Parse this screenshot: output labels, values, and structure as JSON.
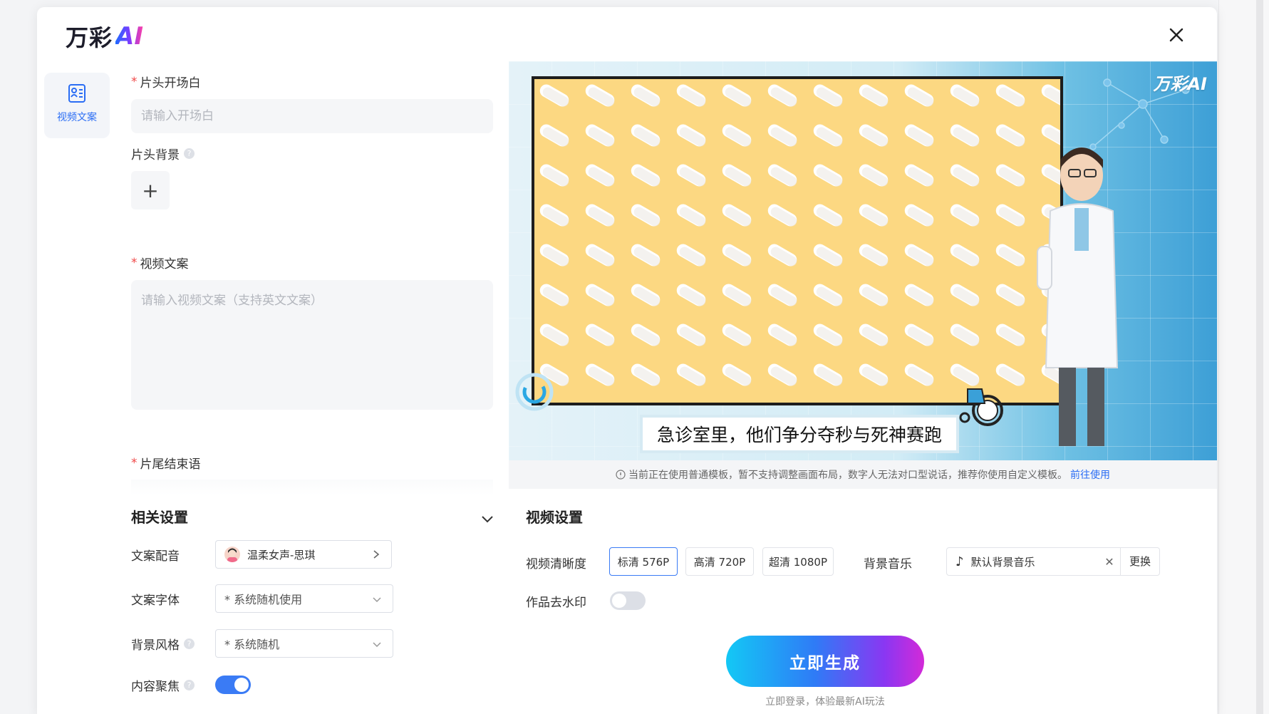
{
  "logo": {
    "text": "万彩",
    "ai": "AI"
  },
  "sidenav": {
    "label": "视频文案"
  },
  "form": {
    "opening": {
      "label": "片头开场白",
      "placeholder": "请输入开场白"
    },
    "opening_bg": {
      "label": "片头背景",
      "add": "+"
    },
    "script": {
      "label": "视频文案",
      "placeholder": "请输入视频文案（支持英文文案）"
    },
    "ending": {
      "label": "片尾结束语"
    }
  },
  "related": {
    "title": "相关设置",
    "voice": {
      "label": "文案配音",
      "value": "温柔女声-思琪"
    },
    "font": {
      "label": "文案字体",
      "value": "* 系统随机使用"
    },
    "bg_style": {
      "label": "背景风格",
      "value": "* 系统随机"
    },
    "focus": {
      "label": "内容聚焦",
      "on": true
    }
  },
  "preview": {
    "caption": "急诊室里，他们争分夺秒与死神赛跑",
    "watermark": "万彩AI"
  },
  "notice": {
    "text": "当前正在使用普通模板，暂不支持调整画面布局，数字人无法对口型说话，推荐你使用自定义模板。",
    "link": "前往使用"
  },
  "video_settings": {
    "title": "视频设置",
    "quality_label": "视频清晰度",
    "qualities": [
      "标清 576P",
      "高清 720P",
      "超清 1080P"
    ],
    "selected_quality": "标清 576P",
    "music_label": "背景音乐",
    "music_value": "默认背景音乐",
    "music_change": "更换",
    "watermark_label": "作品去水印",
    "watermark_on": false
  },
  "generate": {
    "label": "立即生成",
    "sub": "立即登录，体验最新AI玩法"
  },
  "colors": {
    "accent": "#3a7bf5",
    "required": "#f04848"
  }
}
